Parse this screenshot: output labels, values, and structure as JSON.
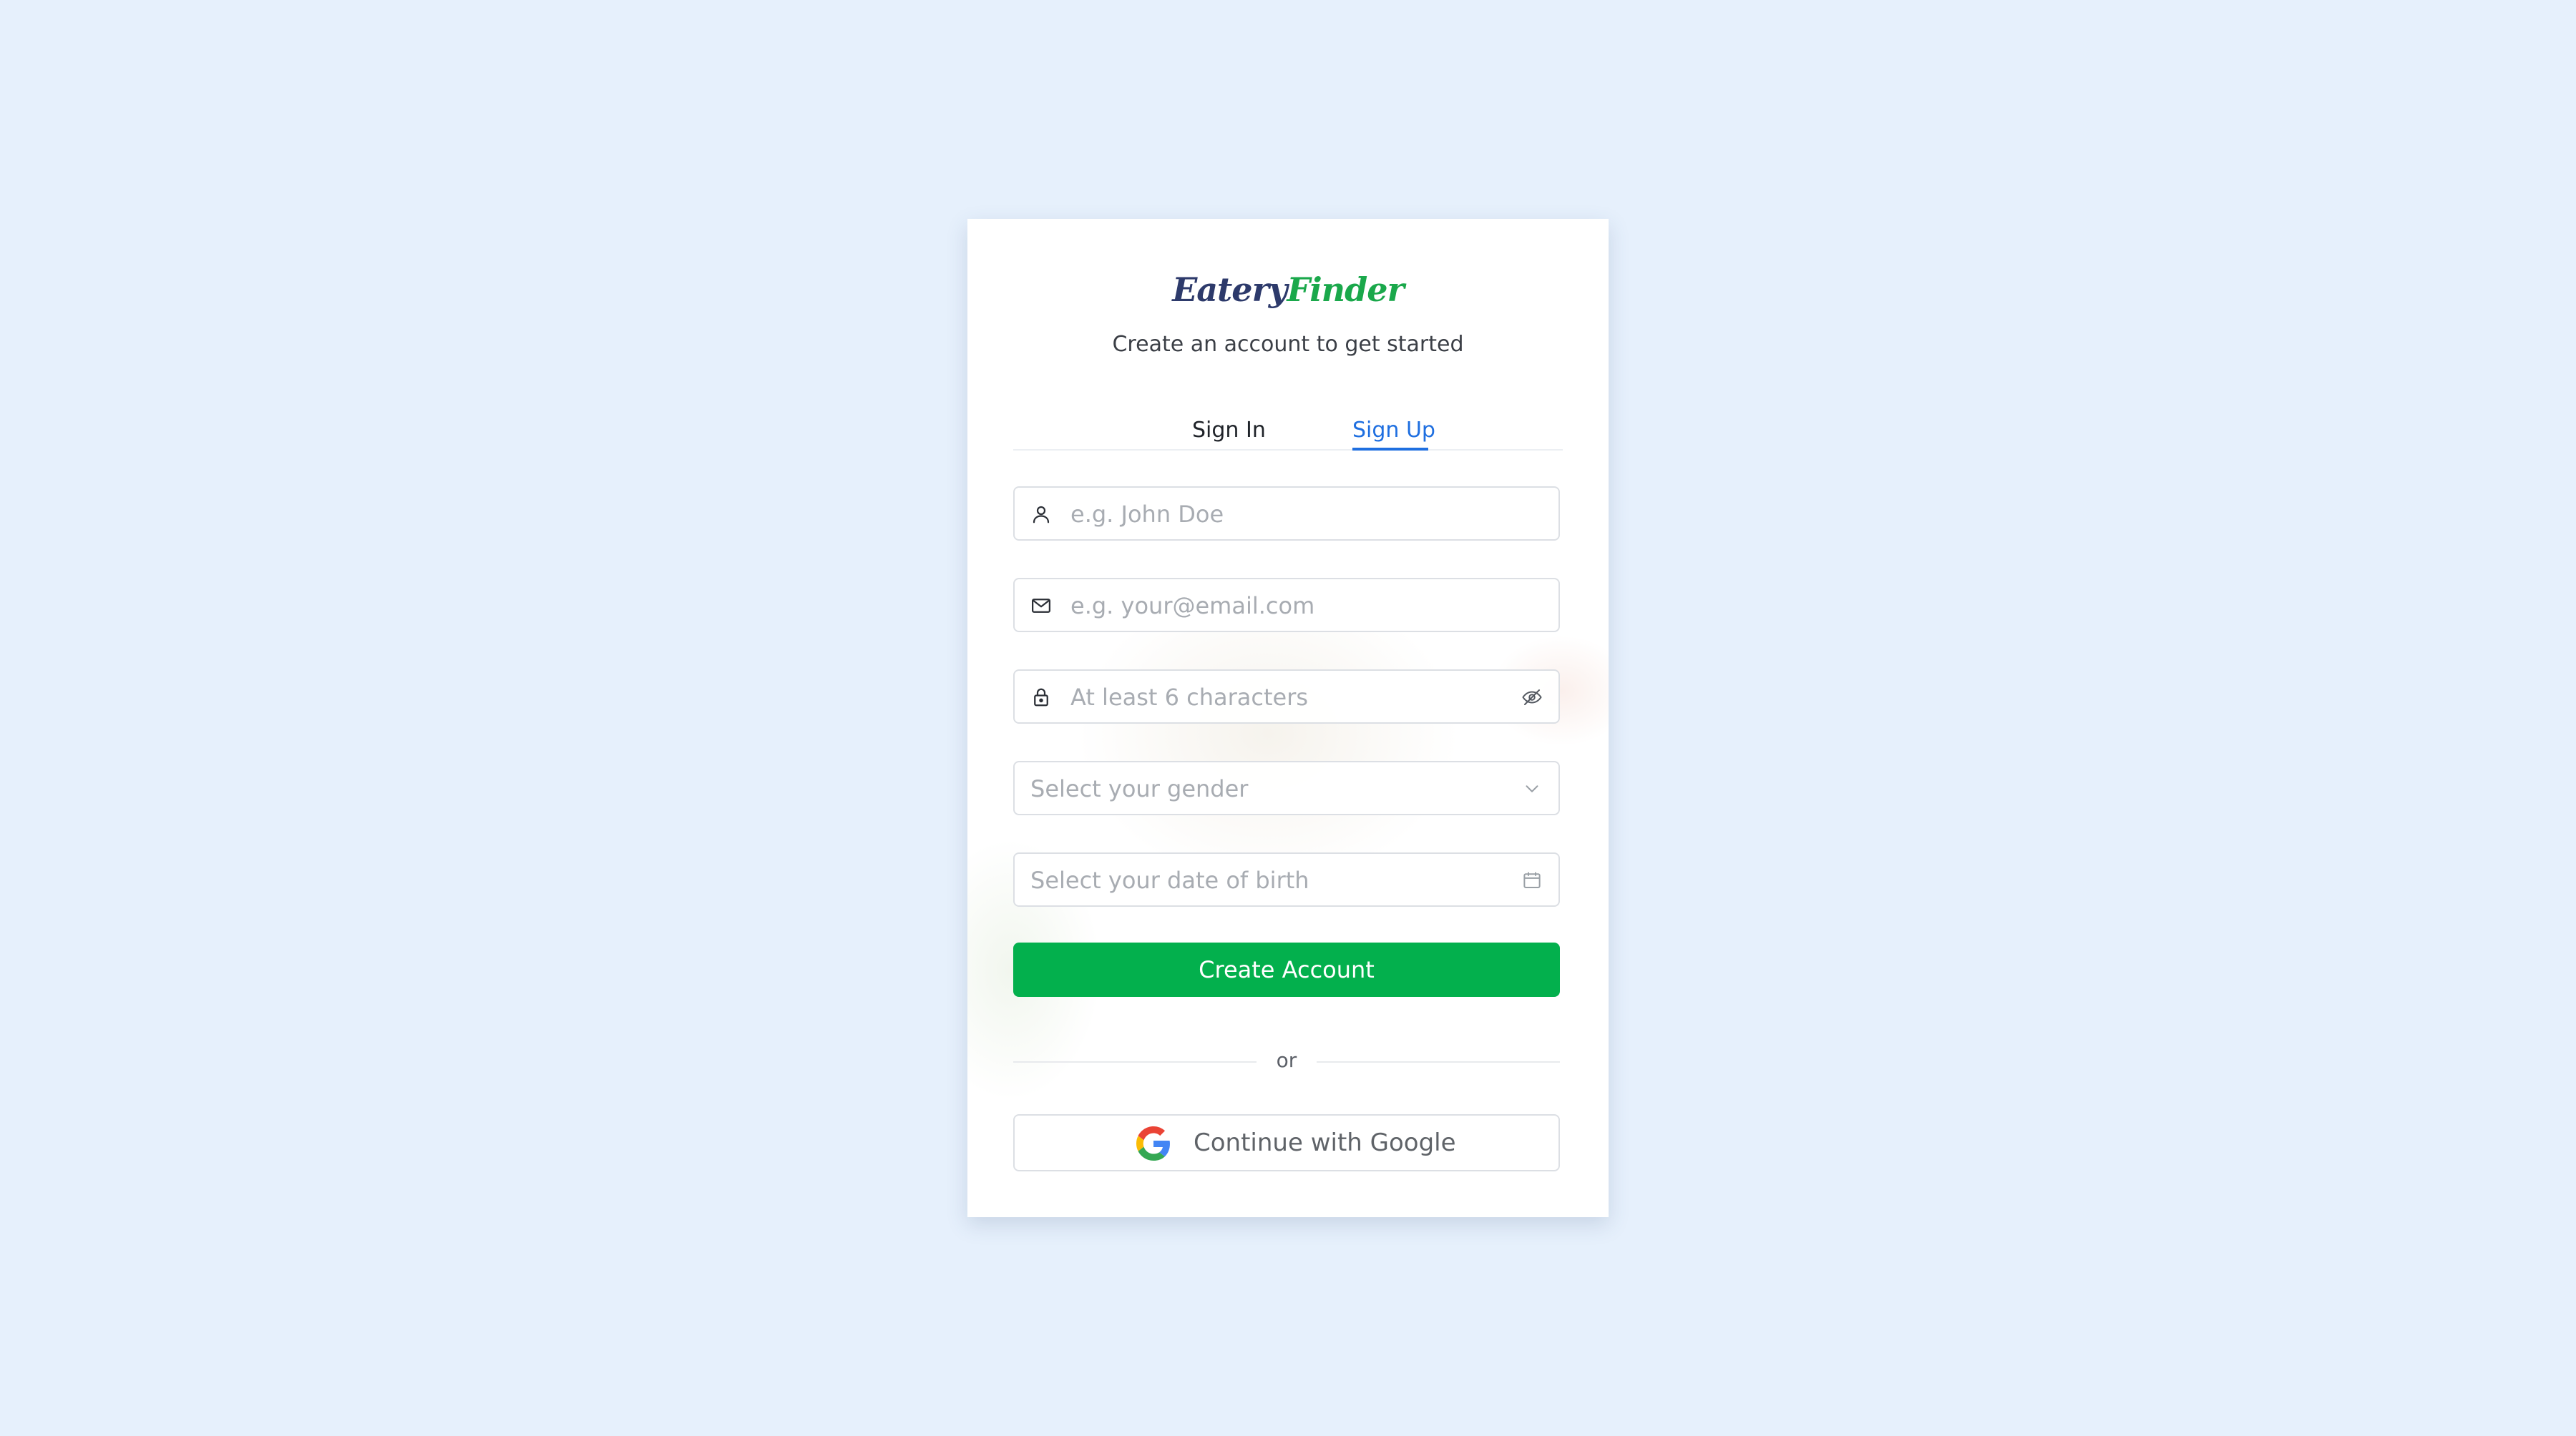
{
  "brand": {
    "name_part1": "Eatery",
    "name_part2": "Finder",
    "tagline": "Create an account to get started"
  },
  "tabs": [
    {
      "label": "Sign In",
      "active": false
    },
    {
      "label": "Sign Up",
      "active": true
    }
  ],
  "form": {
    "name_placeholder": "e.g. John Doe",
    "email_placeholder": "e.g. your@email.com",
    "password_placeholder": "At least 6 characters",
    "gender_placeholder": "Select your gender",
    "dob_placeholder": "Select your date of birth",
    "submit_label": "Create Account"
  },
  "divider_text": "or",
  "google_button_label": "Continue with Google",
  "icons": {
    "name": "user-icon",
    "email": "mail-icon",
    "password": "lock-icon",
    "password_toggle": "eye-off-icon",
    "gender": "chevron-down-icon",
    "dob": "calendar-icon",
    "google": "google-logo-icon"
  },
  "colors": {
    "page_background": "#e6f0fc",
    "brand_dark": "#2d3a6b",
    "brand_green": "#1aa84b",
    "active_tab": "#1f6fe0",
    "primary_button": "#03b04d"
  }
}
